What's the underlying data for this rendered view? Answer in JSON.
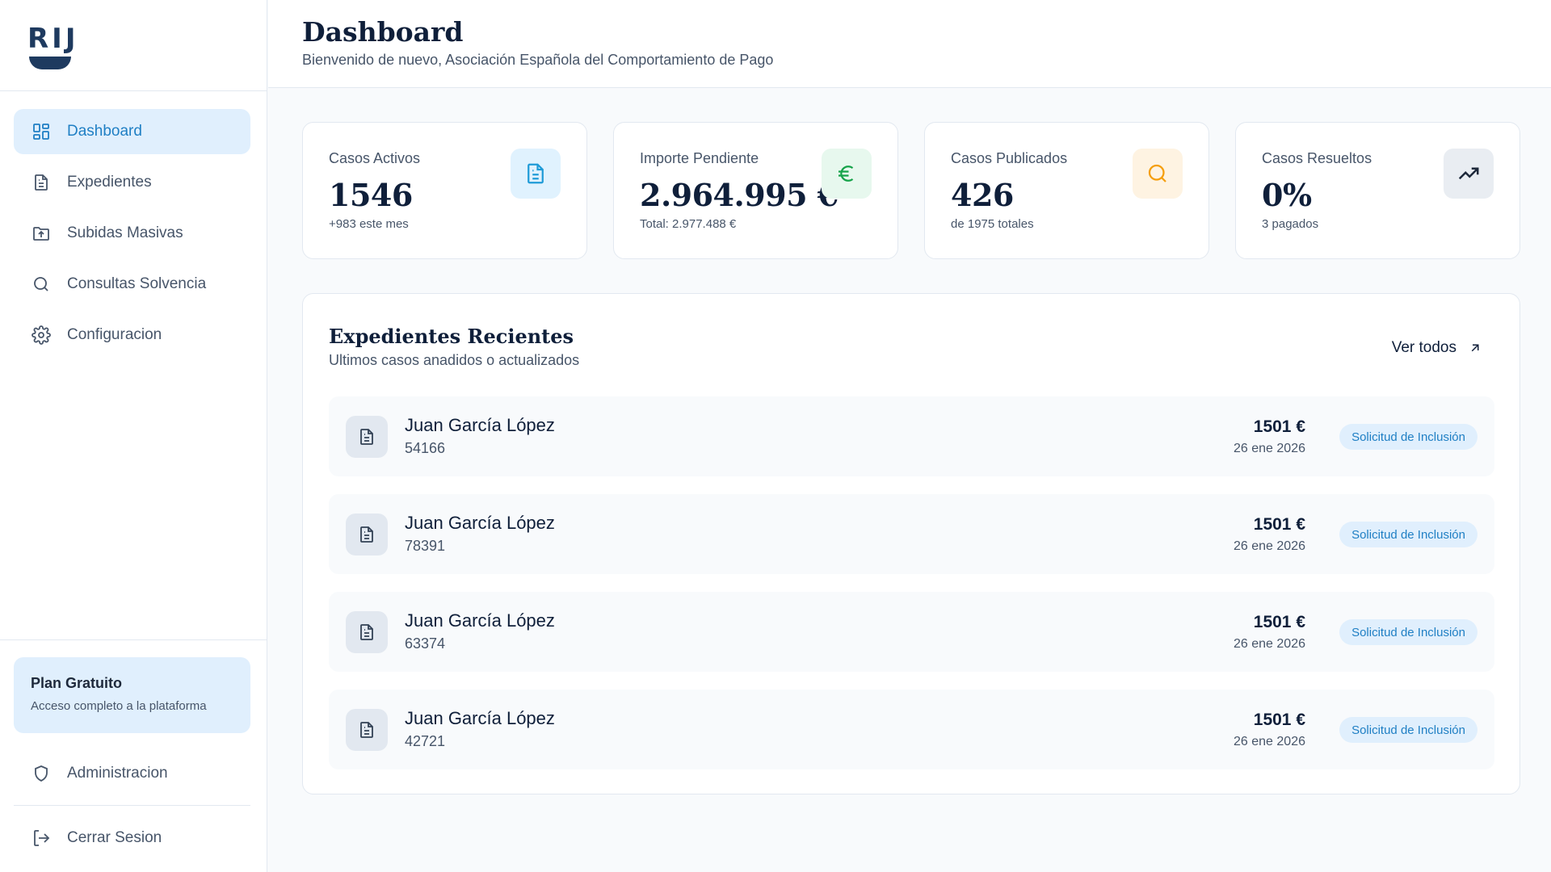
{
  "brand": {
    "logo_text": "RIJ"
  },
  "header": {
    "title": "Dashboard",
    "subtitle": "Bienvenido de nuevo, Asociación Española del Comportamiento de Pago"
  },
  "sidebar": {
    "items": [
      {
        "label": "Dashboard",
        "icon": "grid-icon",
        "active": true
      },
      {
        "label": "Expedientes",
        "icon": "document-icon"
      },
      {
        "label": "Subidas Masivas",
        "icon": "folder-upload-icon"
      },
      {
        "label": "Consultas Solvencia",
        "icon": "search-icon"
      },
      {
        "label": "Configuracion",
        "icon": "gear-icon"
      }
    ],
    "plan": {
      "title": "Plan Gratuito",
      "subtitle": "Acceso completo a la plataforma"
    },
    "admin": {
      "label": "Administracion",
      "icon": "shield-icon"
    },
    "logout": {
      "label": "Cerrar Sesion",
      "icon": "logout-icon"
    }
  },
  "stats": [
    {
      "label": "Casos Activos",
      "value": "1546",
      "note": "+983 este mes",
      "icon": "document-icon",
      "color": "#1f9bd7",
      "bg": "#e0f2fe"
    },
    {
      "label": "Importe Pendiente",
      "value": "2.964.995 €",
      "note": "Total: 2.977.488 €",
      "icon": "euro-icon",
      "color": "#16a34a",
      "bg": "#e7f8ee"
    },
    {
      "label": "Casos Publicados",
      "value": "426",
      "note": "de 1975 totales",
      "icon": "search-icon",
      "color": "#f59e0b",
      "bg": "#fef3e2"
    },
    {
      "label": "Casos Resueltos",
      "value": "0%",
      "note": "3 pagados",
      "icon": "trending-up-icon",
      "color": "#1e293b",
      "bg": "#e9edf2"
    }
  ],
  "recent": {
    "title": "Expedientes Recientes",
    "subtitle": "Ultimos casos anadidos o actualizados",
    "see_all_label": "Ver todos",
    "rows": [
      {
        "name": "Juan García López",
        "id": "54166",
        "amount": "1501 €",
        "date": "26 ene 2026",
        "status": "Solicitud de Inclusión"
      },
      {
        "name": "Juan García López",
        "id": "78391",
        "amount": "1501 €",
        "date": "26 ene 2026",
        "status": "Solicitud de Inclusión"
      },
      {
        "name": "Juan García López",
        "id": "63374",
        "amount": "1501 €",
        "date": "26 ene 2026",
        "status": "Solicitud de Inclusión"
      },
      {
        "name": "Juan García López",
        "id": "42721",
        "amount": "1501 €",
        "date": "26 ene 2026",
        "status": "Solicitud de Inclusión"
      }
    ]
  },
  "colors": {
    "accent": "#1f7fc4",
    "accent_bg": "#e0effd",
    "text_dark": "#0f1f3a",
    "text_muted": "#475569"
  }
}
